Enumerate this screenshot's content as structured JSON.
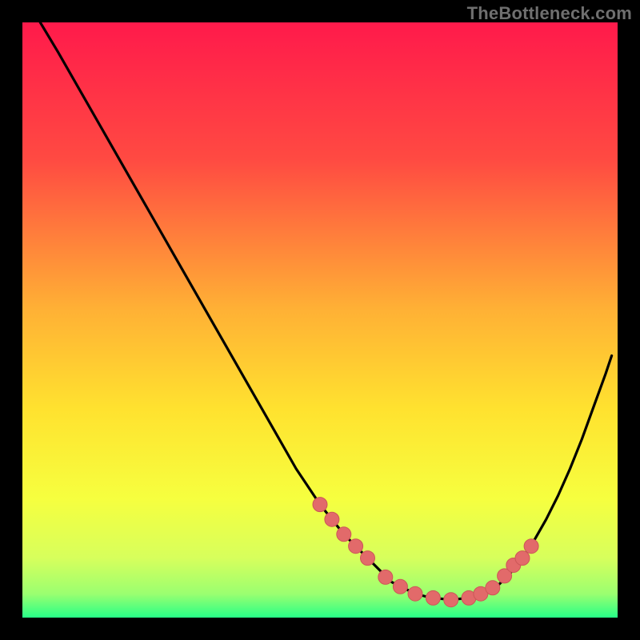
{
  "watermark": "TheBottleneck.com",
  "colors": {
    "gradient_top": "#ff1a4b",
    "gradient_mid_upper": "#ff6a3a",
    "gradient_mid": "#ffd42f",
    "gradient_mid_lower": "#f7ff44",
    "gradient_lower": "#e1ff66",
    "gradient_bottom": "#27ff87",
    "curve": "#000000",
    "marker_fill": "#e26a6a",
    "marker_stroke": "#cc5757"
  },
  "chart_data": {
    "type": "line",
    "title": "",
    "xlabel": "",
    "ylabel": "",
    "xlim": [
      0,
      100
    ],
    "ylim": [
      0,
      100
    ],
    "series": [
      {
        "name": "bottleneck-curve",
        "x": [
          3,
          6,
          10,
          14,
          18,
          22,
          26,
          30,
          34,
          38,
          42,
          46,
          50,
          54,
          56,
          58,
          60,
          62,
          64,
          66,
          68,
          70,
          72,
          74,
          76,
          78,
          80,
          82,
          84,
          86,
          88,
          90,
          92,
          94,
          96,
          98,
          99
        ],
        "y": [
          100,
          95,
          88,
          81,
          74,
          67,
          60,
          53,
          46,
          39,
          32,
          25,
          19,
          14,
          12,
          10,
          8,
          6,
          5,
          4,
          3.5,
          3.2,
          3,
          3.2,
          3.5,
          4.2,
          5.5,
          7.5,
          10,
          13,
          16.5,
          20.5,
          25,
          30,
          35.5,
          41,
          44
        ]
      }
    ],
    "markers": {
      "name": "highlight-points",
      "x": [
        50,
        52,
        54,
        56,
        58,
        61,
        63.5,
        66,
        69,
        72,
        75,
        77,
        79,
        81,
        82.5,
        84,
        85.5
      ],
      "y": [
        19,
        16.5,
        14,
        12,
        10,
        6.8,
        5.2,
        4,
        3.3,
        3,
        3.3,
        4,
        5,
        7,
        8.8,
        10,
        12
      ]
    }
  }
}
